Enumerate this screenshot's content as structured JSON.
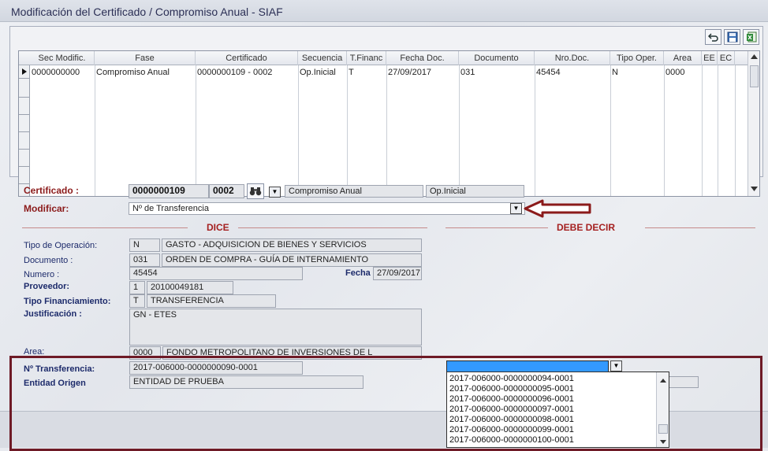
{
  "window": {
    "title": "Modificación del Certificado /  Compromiso  Anual  - SIAF"
  },
  "toolbar": {
    "undo_icon": "undo-icon",
    "save_icon": "save-icon",
    "excel_icon": "excel-icon"
  },
  "grid": {
    "columns": [
      "Sec Modific.",
      "Fase",
      "Certificado",
      "Secuencia",
      "T.Financ",
      "Fecha Doc.",
      "Documento",
      "Nro.Doc.",
      "Tipo Oper.",
      "Area",
      "EE",
      "EC"
    ],
    "rows": [
      [
        "0000000000",
        "Compromiso Anual",
        "0000000109 - 0002",
        "Op.Inicial",
        "T",
        "27/09/2017",
        "031",
        "45454",
        "N",
        "0000",
        "",
        ""
      ]
    ]
  },
  "form": {
    "certificado_label": "Certificado :",
    "certificado_num": "0000000109",
    "certificado_sec": "0002",
    "fase_value": "Compromiso Anual",
    "secuencia_value": "Op.Inicial",
    "modificar_label": "Modificar:",
    "modificar_value": "Nº de Transferencia",
    "dice_title": "DICE",
    "debe_decir_title": "DEBE DECIR",
    "tipo_operacion_label": "Tipo de Operación:",
    "tipo_operacion_code": "N",
    "tipo_operacion_desc": "GASTO - ADQUISICION DE BIENES Y SERVICIOS",
    "documento_label": "Documento :",
    "documento_code": "031",
    "documento_desc": "ORDEN DE COMPRA - GUÍA DE INTERNAMIENTO",
    "numero_label": "Numero :",
    "numero_value": "45454",
    "fecha_label": "Fecha :",
    "fecha_value": "27/09/2017",
    "proveedor_label": "Proveedor:",
    "proveedor_code": "1",
    "proveedor_ruc": "20100049181",
    "tipo_fin_label": "Tipo Financiamiento:",
    "tipo_fin_code": "T",
    "tipo_fin_desc": "TRANSFERENCIA",
    "justificacion_label": "Justificación :",
    "justificacion_value": "GN - ETES",
    "area_label": "Area:",
    "area_code": "0000",
    "area_desc": "FONDO METROPOLITANO DE INVERSIONES DE L",
    "transferencia_label": "Nº Transferencia:",
    "transferencia_value": "2017-006000-0000000090-0001",
    "entidad_label": "Entidad Origen",
    "entidad_value": "ENTIDAD DE PRUEBA"
  },
  "dropdown_list": {
    "items": [
      "2017-006000-0000000094-0001",
      "2017-006000-0000000095-0001",
      "2017-006000-0000000096-0001",
      "2017-006000-0000000097-0001",
      "2017-006000-0000000098-0001",
      "2017-006000-0000000099-0001",
      "2017-006000-0000000100-0001"
    ]
  },
  "colors": {
    "accent_red": "#8b1a1a",
    "selection_blue": "#3399ff",
    "frame": "#6e1a26"
  }
}
